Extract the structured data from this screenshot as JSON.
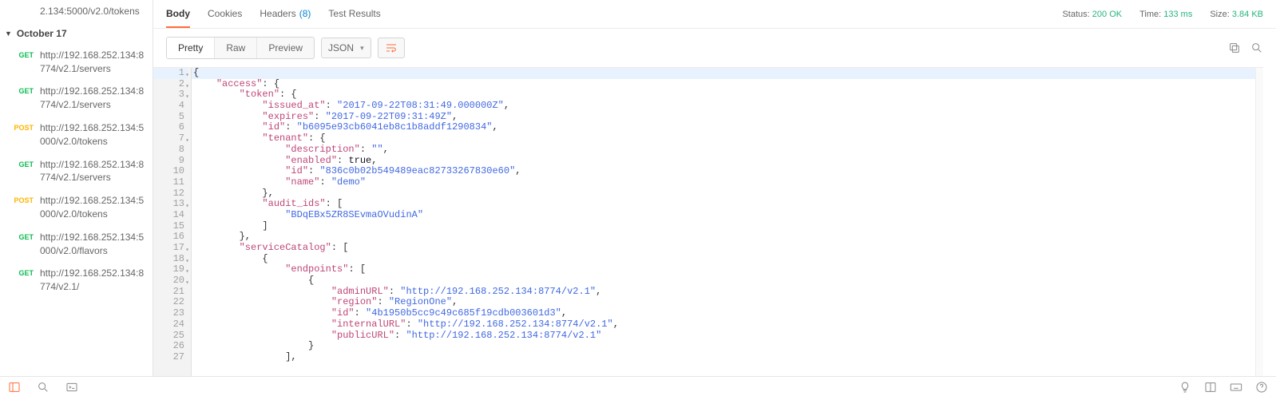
{
  "sidebar": {
    "top_items": [
      {
        "method": "",
        "url": "2.134:5000/v2.0/tokens"
      }
    ],
    "date_header": "October 17",
    "items": [
      {
        "method": "GET",
        "url": "http://192.168.252.134:8774/v2.1/servers"
      },
      {
        "method": "GET",
        "url": "http://192.168.252.134:8774/v2.1/servers"
      },
      {
        "method": "POST",
        "url": "http://192.168.252.134:5000/v2.0/tokens"
      },
      {
        "method": "GET",
        "url": "http://192.168.252.134:8774/v2.1/servers"
      },
      {
        "method": "POST",
        "url": "http://192.168.252.134:5000/v2.0/tokens"
      },
      {
        "method": "GET",
        "url": "http://192.168.252.134:5000/v2.0/flavors"
      },
      {
        "method": "GET",
        "url": "http://192.168.252.134:8774/v2.1/"
      }
    ]
  },
  "response": {
    "tabs": [
      {
        "label": "Body",
        "active": true
      },
      {
        "label": "Cookies"
      },
      {
        "label": "Headers",
        "count": "(8)"
      },
      {
        "label": "Test Results"
      }
    ],
    "status_label": "Status:",
    "status_value": "200 OK",
    "time_label": "Time:",
    "time_value": "133 ms",
    "size_label": "Size:",
    "size_value": "3.84 KB",
    "view_modes": [
      "Pretty",
      "Raw",
      "Preview"
    ],
    "view_active": "Pretty",
    "format": "JSON"
  },
  "code": {
    "lines": [
      {
        "n": 1,
        "fold": true,
        "hl": true,
        "html": "<span class='pun'>{</span>"
      },
      {
        "n": 2,
        "fold": true,
        "html": "    <span class='key'>\"access\"</span><span class='pun'>: {</span>"
      },
      {
        "n": 3,
        "fold": true,
        "html": "        <span class='key'>\"token\"</span><span class='pun'>: {</span>"
      },
      {
        "n": 4,
        "html": "            <span class='key'>\"issued_at\"</span><span class='pun'>: </span><span class='str'>\"2017-09-22T08:31:49.000000Z\"</span><span class='pun'>,</span>"
      },
      {
        "n": 5,
        "html": "            <span class='key'>\"expires\"</span><span class='pun'>: </span><span class='str'>\"2017-09-22T09:31:49Z\"</span><span class='pun'>,</span>"
      },
      {
        "n": 6,
        "html": "            <span class='key'>\"id\"</span><span class='pun'>: </span><span class='str'>\"b6095e93cb6041eb8c1b8addf1290834\"</span><span class='pun'>,</span>"
      },
      {
        "n": 7,
        "fold": true,
        "html": "            <span class='key'>\"tenant\"</span><span class='pun'>: {</span>"
      },
      {
        "n": 8,
        "html": "                <span class='key'>\"description\"</span><span class='pun'>: </span><span class='str'>\"\"</span><span class='pun'>,</span>"
      },
      {
        "n": 9,
        "html": "                <span class='key'>\"enabled\"</span><span class='pun'>: </span><span class='lit'>true</span><span class='pun'>,</span>"
      },
      {
        "n": 10,
        "html": "                <span class='key'>\"id\"</span><span class='pun'>: </span><span class='str'>\"836c0b02b549489eac82733267830e60\"</span><span class='pun'>,</span>"
      },
      {
        "n": 11,
        "html": "                <span class='key'>\"name\"</span><span class='pun'>: </span><span class='str'>\"demo\"</span>"
      },
      {
        "n": 12,
        "html": "            <span class='pun'>},</span>"
      },
      {
        "n": 13,
        "fold": true,
        "html": "            <span class='key'>\"audit_ids\"</span><span class='pun'>: [</span>"
      },
      {
        "n": 14,
        "html": "                <span class='str'>\"BDqEBx5ZR8SEvmaOVudinA\"</span>"
      },
      {
        "n": 15,
        "html": "            <span class='pun'>]</span>"
      },
      {
        "n": 16,
        "html": "        <span class='pun'>},</span>"
      },
      {
        "n": 17,
        "fold": true,
        "html": "        <span class='key'>\"serviceCatalog\"</span><span class='pun'>: [</span>"
      },
      {
        "n": 18,
        "fold": true,
        "html": "            <span class='pun'>{</span>"
      },
      {
        "n": 19,
        "fold": true,
        "html": "                <span class='key'>\"endpoints\"</span><span class='pun'>: [</span>"
      },
      {
        "n": 20,
        "fold": true,
        "html": "                    <span class='pun'>{</span>"
      },
      {
        "n": 21,
        "html": "                        <span class='key'>\"adminURL\"</span><span class='pun'>: </span><span class='str'>\"http://192.168.252.134:8774/v2.1\"</span><span class='pun'>,</span>"
      },
      {
        "n": 22,
        "html": "                        <span class='key'>\"region\"</span><span class='pun'>: </span><span class='str'>\"RegionOne\"</span><span class='pun'>,</span>"
      },
      {
        "n": 23,
        "html": "                        <span class='key'>\"id\"</span><span class='pun'>: </span><span class='str'>\"4b1950b5cc9c49c685f19cdb003601d3\"</span><span class='pun'>,</span>"
      },
      {
        "n": 24,
        "html": "                        <span class='key'>\"internalURL\"</span><span class='pun'>: </span><span class='str'>\"http://192.168.252.134:8774/v2.1\"</span><span class='pun'>,</span>"
      },
      {
        "n": 25,
        "html": "                        <span class='key'>\"publicURL\"</span><span class='pun'>: </span><span class='str'>\"http://192.168.252.134:8774/v2.1\"</span>"
      },
      {
        "n": 26,
        "html": "                    <span class='pun'>}</span>"
      },
      {
        "n": 27,
        "html": "                <span class='pun'>],</span>"
      }
    ]
  }
}
